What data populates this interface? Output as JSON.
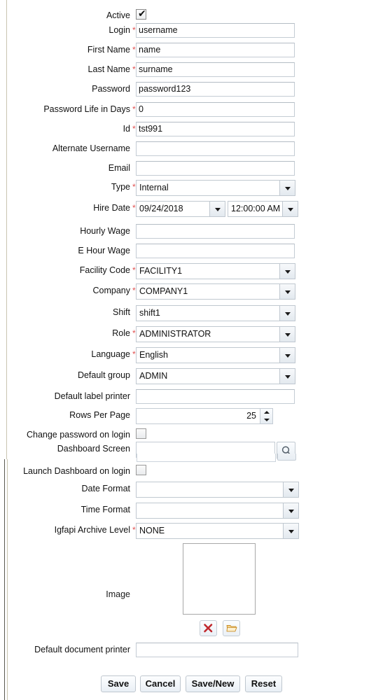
{
  "form": {
    "fields": [
      {
        "label": "Active",
        "required": false,
        "type": "checkbox",
        "checked": true,
        "value": ""
      },
      {
        "label": "Login",
        "required": true,
        "type": "text",
        "value": "username"
      },
      {
        "label": "First Name",
        "required": true,
        "type": "text",
        "value": "name"
      },
      {
        "label": "Last Name",
        "required": true,
        "type": "text",
        "value": "surname"
      },
      {
        "label": "Password",
        "required": false,
        "type": "text",
        "value": "password123"
      },
      {
        "label": "Password Life in Days",
        "required": true,
        "type": "text",
        "value": "0"
      },
      {
        "label": "Id",
        "required": true,
        "type": "text",
        "value": "tst991"
      },
      {
        "label": "Alternate Username",
        "required": false,
        "type": "text",
        "value": ""
      },
      {
        "label": "Email",
        "required": false,
        "type": "text",
        "value": ""
      },
      {
        "label": "Type",
        "required": true,
        "type": "select",
        "value": "Internal"
      },
      {
        "label": "Hire Date",
        "required": true,
        "type": "datetime",
        "value": "09/24/2018",
        "time_value": "12:00:00 AM"
      },
      {
        "label": "Hourly Wage",
        "required": false,
        "type": "text",
        "value": ""
      },
      {
        "label": "E Hour Wage",
        "required": false,
        "type": "text",
        "value": ""
      },
      {
        "label": "Facility Code",
        "required": true,
        "type": "select",
        "value": "FACILITY1"
      },
      {
        "label": "Company",
        "required": true,
        "type": "select",
        "value": "COMPANY1"
      },
      {
        "label": "Shift",
        "required": false,
        "type": "select",
        "value": "shift1"
      },
      {
        "label": "Role",
        "required": true,
        "type": "select",
        "value": "ADMINISTRATOR"
      },
      {
        "label": "Language",
        "required": true,
        "type": "select",
        "value": "English"
      },
      {
        "label": "Default group",
        "required": false,
        "type": "select",
        "value": "ADMIN"
      },
      {
        "label": "Default label printer",
        "required": false,
        "type": "text",
        "value": ""
      },
      {
        "label": "Rows Per Page",
        "required": false,
        "type": "spinner",
        "value": "25"
      },
      {
        "label": "Change password on login",
        "required": false,
        "type": "checkbox",
        "checked": false,
        "value": ""
      },
      {
        "label": "Dashboard Screen",
        "required": false,
        "type": "lookup",
        "value": ""
      },
      {
        "label": "Launch Dashboard on login",
        "required": false,
        "type": "checkbox",
        "checked": false,
        "value": ""
      },
      {
        "label": "Date Format",
        "required": false,
        "type": "select",
        "value": ""
      },
      {
        "label": "Time Format",
        "required": false,
        "type": "select",
        "value": ""
      },
      {
        "label": "Igfapi Archive Level",
        "required": true,
        "type": "select",
        "value": "NONE"
      }
    ],
    "image_field": {
      "label": "Image",
      "clear_icon": "red-x-icon",
      "browse_icon": "open-folder-icon"
    },
    "document_printer": {
      "label": "Default document printer",
      "value": ""
    },
    "required_marker": "*",
    "checkbox_tick": "✔",
    "lookup_icon": "magnifier-icon"
  },
  "actions": {
    "save": "Save",
    "cancel": "Cancel",
    "save_new": "Save/New",
    "reset": "Reset"
  },
  "colors": {
    "required_asterisk": "#e05050",
    "clear_icon": "#c0282d",
    "folder_icon": "#e8a33d",
    "panel_rule": "#c8c4b0",
    "input_border": "#c4ccd4"
  }
}
